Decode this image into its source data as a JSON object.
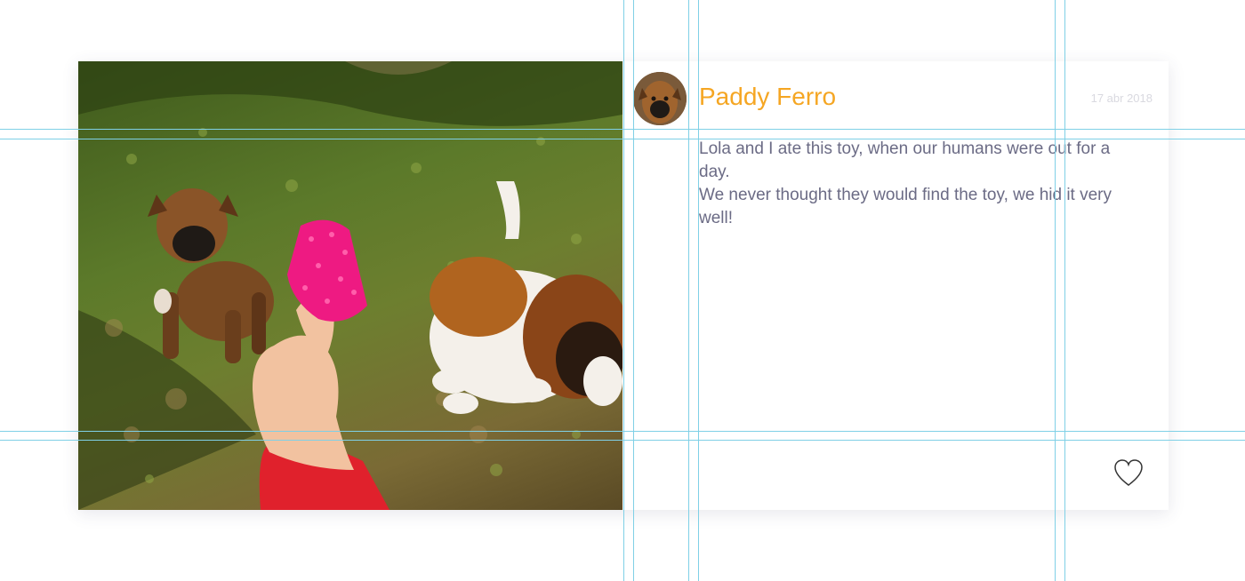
{
  "post": {
    "author": "Paddy Ferro",
    "date": "17 abr 2018",
    "body_lines": [
      "Lola and I ate this toy, when our humans were out for a day.",
      "We never thought they would find the toy, we hid it very well!"
    ],
    "like_icon": "heart-outline-icon"
  },
  "colors": {
    "author": "#f5a623",
    "body_text": "#6b6b85",
    "date": "#d9d9e0",
    "guide": "#7fd0e6"
  }
}
